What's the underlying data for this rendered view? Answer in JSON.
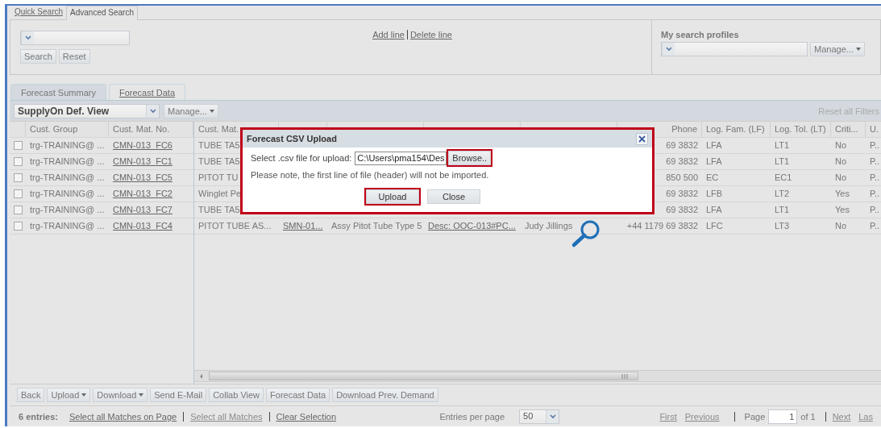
{
  "search_tabs": [
    {
      "label": "Quick Search",
      "selected": false
    },
    {
      "label": "Advanced Search",
      "selected": true
    }
  ],
  "search_panel": {
    "buttons": [
      "Search",
      "Reset"
    ],
    "line_links": [
      "Add line",
      "Delete line"
    ],
    "profiles_title": "My search profiles",
    "profiles_manage": "Manage..."
  },
  "view_tabs": [
    {
      "label": "Forecast Summary",
      "selected": true
    },
    {
      "label": "Forecast Data",
      "selected": false
    }
  ],
  "toolbar": {
    "view": "SupplyOn Def. View",
    "manage": "Manage...",
    "reset_filters": "Reset all Filters"
  },
  "table": {
    "columns": [
      {
        "label": "Cust. Group",
        "kind": "text"
      },
      {
        "label": "Cust. Mat. No.",
        "kind": "link"
      },
      {
        "label": "Cust. Mat.",
        "kind": "text"
      },
      {
        "kind": "link"
      },
      {
        "kind": "text"
      },
      {
        "kind": "link"
      },
      {
        "kind": "text"
      },
      {
        "label": "Phone",
        "kind": "number"
      },
      {
        "label": "Log. Fam. (LF)",
        "kind": "text"
      },
      {
        "label": "Log. Tol. (LT)",
        "kind": "text"
      },
      {
        "label": "Criti...",
        "kind": "text"
      },
      {
        "label": "U.",
        "kind": "text"
      }
    ],
    "rows": [
      {
        "checked": false,
        "cells": [
          "trg-TRAINING@ ...",
          "CMN-013_FC6",
          "TUBE TA5",
          null,
          null,
          null,
          null,
          "69 3832",
          "LFA",
          "LT1",
          "No",
          "P.."
        ]
      },
      {
        "checked": false,
        "cells": [
          "trg-TRAINING@ ...",
          "CMN-013_FC1",
          "TUBE TA5",
          null,
          null,
          null,
          null,
          "69 3832",
          "LFA",
          "LT1",
          "No",
          "P.."
        ]
      },
      {
        "checked": false,
        "cells": [
          "trg-TRAINING@ ...",
          "CMN-013_FC5",
          "PITOT TU",
          null,
          null,
          null,
          null,
          "850 500",
          "EC",
          "EC1",
          "No",
          "P.."
        ]
      },
      {
        "checked": false,
        "cells": [
          "trg-TRAINING@ ...",
          "CMN-013_FC2",
          "Winglet Pe",
          null,
          null,
          null,
          null,
          "69 3832",
          "LFB",
          "LT2",
          "Yes",
          "P.."
        ]
      },
      {
        "checked": false,
        "cells": [
          "trg-TRAINING@ ...",
          "CMN-013_FC7",
          "TUBE TA5",
          null,
          null,
          null,
          null,
          "69 3832",
          "LFA",
          "LT1",
          "Yes",
          "P.."
        ]
      },
      {
        "checked": false,
        "cells": [
          "trg-TRAINING@ ...",
          "CMN-013_FC4",
          "PITOT TUBE AS...",
          "SMN-01...",
          "Assy Pitot Tube Type 5",
          "Desc: OOC-013#PC...",
          "Judy Jillings",
          "+44 1179 69 3832",
          "LFC",
          "LT3",
          "No",
          "P.."
        ]
      }
    ]
  },
  "actions": [
    {
      "label": "Back",
      "menu": false
    },
    {
      "label": "Upload",
      "menu": true
    },
    {
      "label": "Download",
      "menu": true
    },
    {
      "label": "Send E-Mail",
      "menu": false
    },
    {
      "label": "Collab View",
      "menu": false
    },
    {
      "label": "Forecast Data",
      "menu": false
    },
    {
      "label": "Download Prev. Demand",
      "menu": false
    }
  ],
  "status_bar": {
    "count": "6 entries:",
    "links": [
      {
        "label": "Select all Matches on Page",
        "disabled": false
      },
      {
        "label": "Select all Matches",
        "disabled": true
      },
      {
        "label": "Clear Selection",
        "disabled": false
      }
    ],
    "per_page_label": "Entries per page",
    "per_page": "50",
    "nav_back": [
      {
        "label": "First",
        "disabled": true
      },
      {
        "label": "Previous",
        "disabled": true
      }
    ],
    "page_label": "Page",
    "page": "1",
    "page_total": "of 1",
    "nav_forward": [
      {
        "label": "Next",
        "disabled": true
      },
      {
        "label": "Las",
        "disabled": true
      }
    ]
  },
  "dialog": {
    "title": "Forecast CSV Upload",
    "file_label": "Select .csv file for upload:",
    "file": "C:\\Users\\pma154\\Des",
    "browse": {
      "label": "Browse..",
      "highlighted": true
    },
    "note": "Please note, the first line of file (header) will not be imported.",
    "buttons": [
      {
        "label": "Upload",
        "highlighted": true
      },
      {
        "label": "Close",
        "highlighted": false
      }
    ]
  }
}
